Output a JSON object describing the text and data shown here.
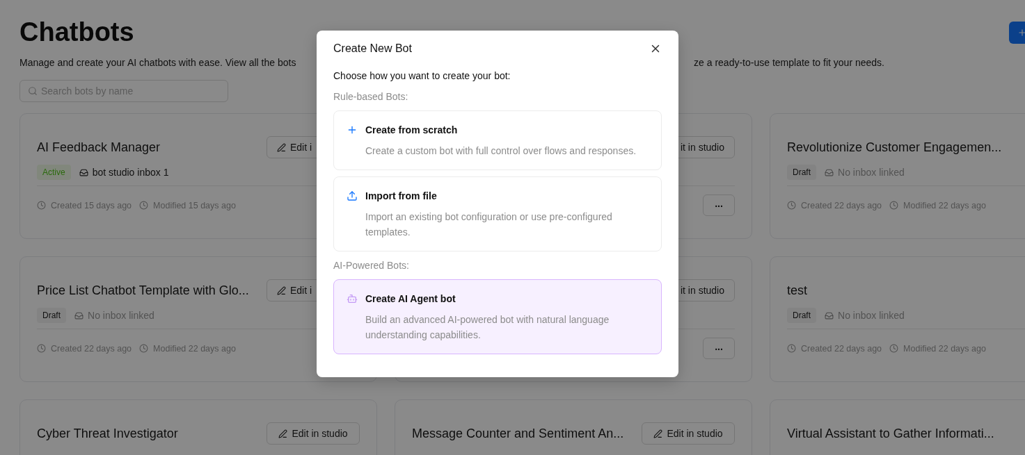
{
  "page": {
    "title": "Chatbots",
    "description_parts": [
      "Manage and create your AI chatbots with ease. View all the bots",
      "ze a ready-to-use template to fit your needs."
    ],
    "search": {
      "placeholder": "Search bots by name"
    }
  },
  "bots": [
    {
      "title": "AI Feedback Manager",
      "edit": {
        "label": "Edit i",
        "kind": "head"
      },
      "status": {
        "label": "Active",
        "kind": "active"
      },
      "inbox": "bot studio inbox 1",
      "inbox_linked": true,
      "created": "Created 15 days ago",
      "modified": "Modified 15 days ago"
    },
    {
      "edit": {
        "label": "it in studio",
        "kind": "tail"
      },
      "more_label": "..."
    },
    {
      "title": "Revolutionize Customer Engagemen...",
      "status": {
        "label": "Draft",
        "kind": "draft"
      },
      "inbox": "No inbox linked",
      "inbox_linked": false,
      "created": "Created 22 days ago",
      "modified": "Modified 22 days ago"
    },
    {
      "title": "Price List Chatbot Template with Glo...",
      "edit": {
        "label": "Edit i",
        "kind": "head"
      },
      "status": {
        "label": "Draft",
        "kind": "draft"
      },
      "inbox": "No inbox linked",
      "inbox_linked": false,
      "created": "Created 22 days ago",
      "modified": "Modified 22 days ago"
    },
    {
      "edit": {
        "label": "it in studio",
        "kind": "tail"
      },
      "more_label": "..."
    },
    {
      "title": "test",
      "status": {
        "label": "Draft",
        "kind": "draft"
      },
      "inbox": "No inbox linked",
      "inbox_linked": false,
      "created": "Created 22 days ago",
      "modified": "Modified 22 days ago"
    },
    {
      "title": "Cyber Threat Investigator",
      "edit": {
        "label": "Edit in studio",
        "kind": "whole"
      }
    },
    {
      "title": "Message Counter and Sentiment An...",
      "edit": {
        "label": "Edit in studio",
        "kind": "whole"
      }
    },
    {
      "title": "Virtual Assistant to Gather Informati..."
    }
  ],
  "dialog": {
    "title": "Create New Bot",
    "prompt": "Choose how you want to create your bot:",
    "sections": [
      {
        "heading": "Rule-based Bots:",
        "options": [
          {
            "kind": "scratch",
            "title": "Create from scratch",
            "description": "Create a custom bot with full control over flows and responses.",
            "selected": false
          },
          {
            "kind": "import",
            "title": "Import from file",
            "description": "Import an existing bot configuration or use pre-configured templates.",
            "selected": false
          }
        ]
      },
      {
        "heading": "AI-Powered Bots:",
        "options": [
          {
            "kind": "ai",
            "title": "Create AI Agent bot",
            "description": "Build an advanced AI-powered bot with natural language understanding capabilities.",
            "selected": true
          }
        ]
      }
    ]
  }
}
